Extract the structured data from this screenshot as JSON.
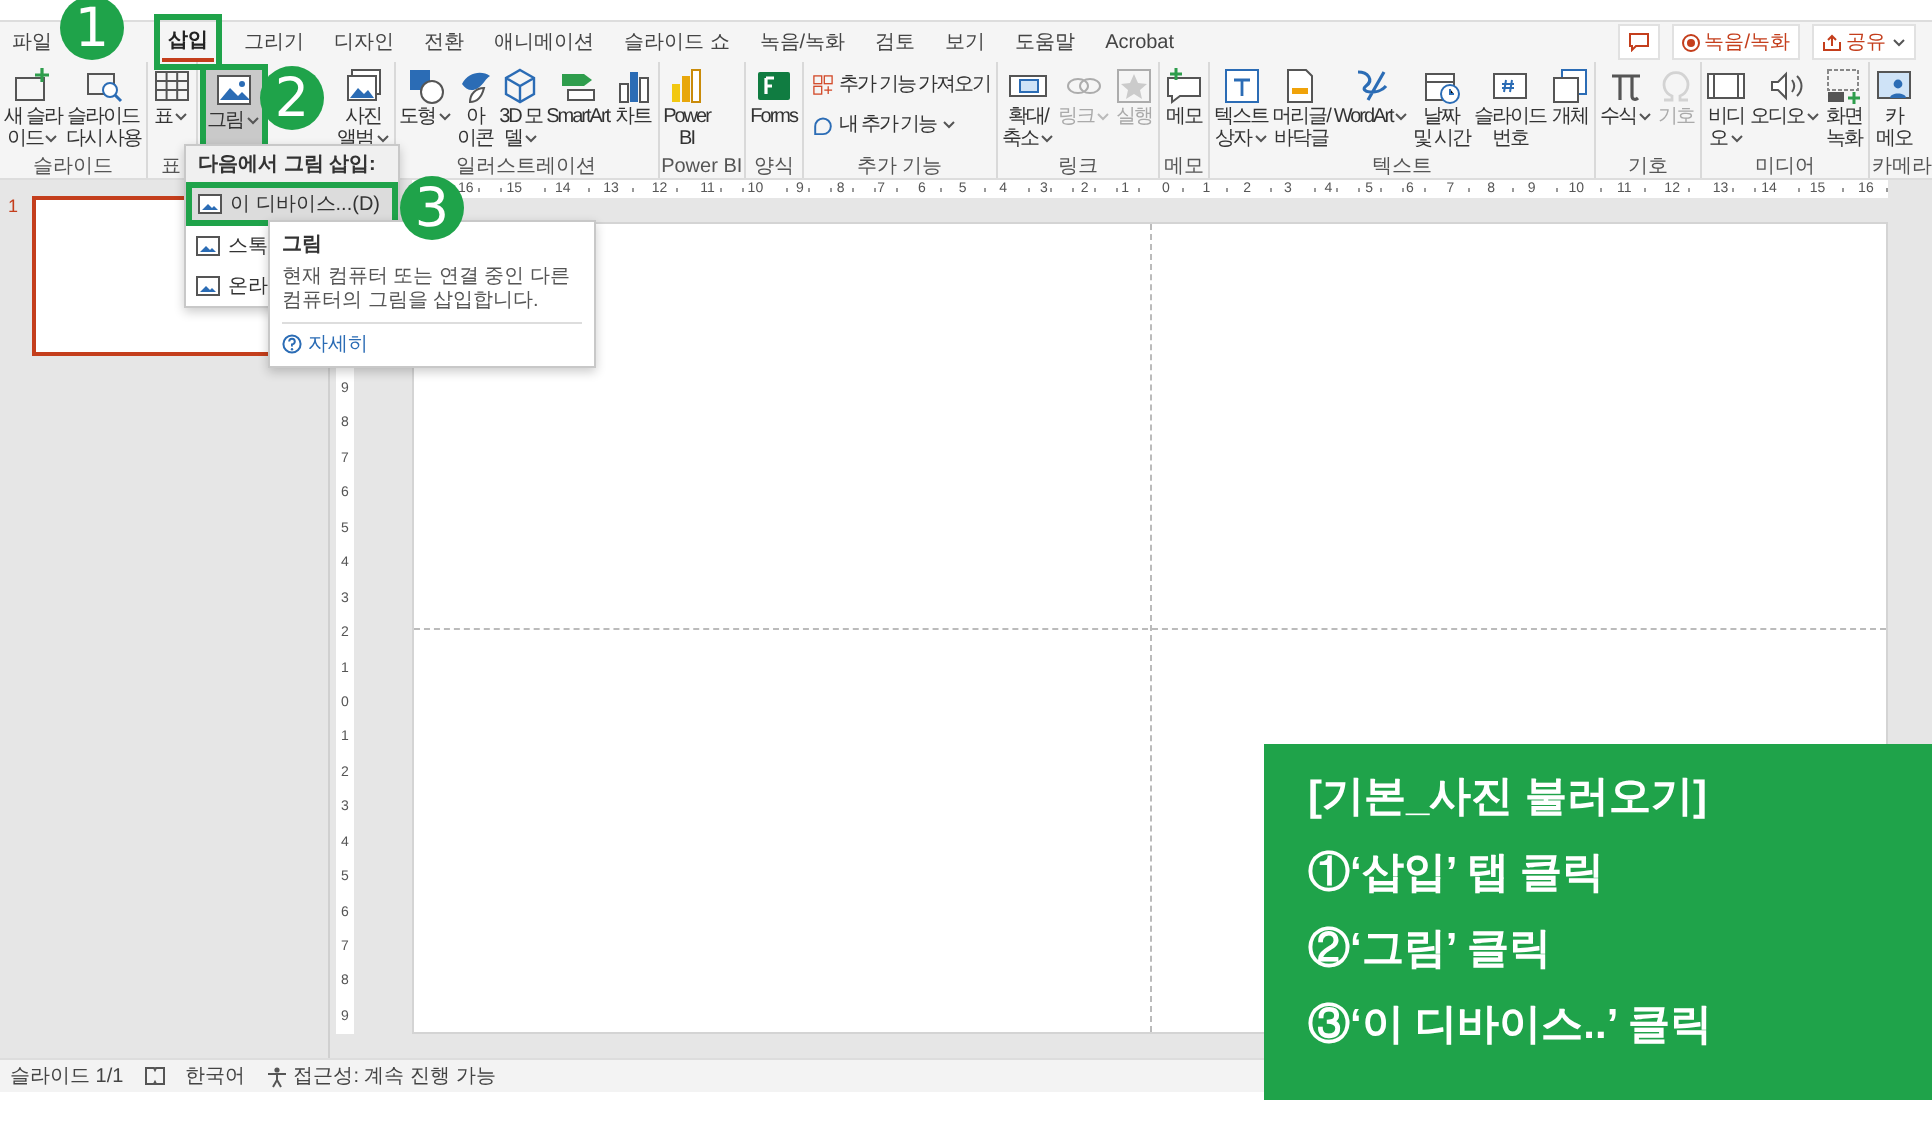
{
  "tabs": [
    {
      "label": "파일",
      "selected": false
    },
    {
      "label": "삽입",
      "selected": true
    },
    {
      "label": "그리기",
      "selected": false
    },
    {
      "label": "디자인",
      "selected": false
    },
    {
      "label": "전환",
      "selected": false
    },
    {
      "label": "애니메이션",
      "selected": false
    },
    {
      "label": "슬라이드 쇼",
      "selected": false
    },
    {
      "label": "녹음/녹화",
      "selected": false
    },
    {
      "label": "검토",
      "selected": false
    },
    {
      "label": "보기",
      "selected": false
    },
    {
      "label": "도움말",
      "selected": false
    },
    {
      "label": "Acrobat",
      "selected": false
    }
  ],
  "header_buttons": [
    {
      "kind": "comment"
    },
    {
      "kind": "record",
      "label": "녹음/녹화"
    },
    {
      "kind": "share",
      "label": "공유"
    }
  ],
  "ribbon_groups": [
    {
      "label": "슬라이드",
      "kind": "large",
      "buttons": [
        {
          "lines": [
            "새 슬라",
            "이드"
          ],
          "dropdown": true,
          "pressed": false,
          "disabled": false
        },
        {
          "lines": [
            "슬라이드",
            "다시 사용"
          ],
          "dropdown": false,
          "pressed": false,
          "disabled": false
        }
      ]
    },
    {
      "label": "표",
      "kind": "large",
      "buttons": [
        {
          "lines": [
            "표"
          ],
          "dropdown": true,
          "pressed": false,
          "disabled": false
        }
      ]
    },
    {
      "kind": "large",
      "buttons": [
        {
          "lines": [
            "그림"
          ],
          "dropdown": true,
          "pressed": true,
          "disabled": false
        },
        {
          "lines": [
            "사진",
            "앨범"
          ],
          "dropdown": true,
          "pressed": false,
          "disabled": false
        }
      ]
    },
    {
      "label": "일러스트레이션",
      "kind": "large",
      "buttons": [
        {
          "lines": [
            "도형"
          ],
          "dropdown": true,
          "pressed": false,
          "disabled": false
        },
        {
          "lines": [
            "아",
            "이콘"
          ],
          "dropdown": false,
          "pressed": false,
          "disabled": false
        },
        {
          "lines": [
            "3D 모",
            "델"
          ],
          "dropdown": true,
          "pressed": false,
          "disabled": false
        },
        {
          "lines": [
            "SmartArt"
          ],
          "dropdown": false,
          "pressed": false,
          "disabled": false
        },
        {
          "lines": [
            "차트"
          ],
          "dropdown": false,
          "pressed": false,
          "disabled": false
        }
      ]
    },
    {
      "label": "Power BI",
      "kind": "large",
      "buttons": [
        {
          "lines": [
            "Power",
            "BI"
          ],
          "dropdown": false,
          "pressed": false,
          "disabled": false
        }
      ]
    },
    {
      "label": "양식",
      "kind": "large",
      "buttons": [
        {
          "lines": [
            "Forms"
          ],
          "dropdown": false,
          "pressed": false,
          "disabled": false
        }
      ]
    },
    {
      "label": "추가 기능",
      "kind": "small",
      "buttons": [
        {
          "lines": [
            "추가 기능 가져오기"
          ],
          "dropdown": false,
          "pressed": false,
          "disabled": false
        },
        {
          "lines": [
            "내 추가 기능"
          ],
          "dropdown": true,
          "pressed": false,
          "disabled": false
        }
      ]
    },
    {
      "label": "링크",
      "kind": "large",
      "buttons": [
        {
          "lines": [
            "확대/",
            "축소"
          ],
          "dropdown": true,
          "pressed": false,
          "disabled": false
        },
        {
          "lines": [
            "링크"
          ],
          "dropdown": true,
          "pressed": false,
          "disabled": true
        },
        {
          "lines": [
            "실행"
          ],
          "dropdown": false,
          "pressed": false,
          "disabled": true
        }
      ]
    },
    {
      "label": "메모",
      "kind": "large",
      "buttons": [
        {
          "lines": [
            "메모"
          ],
          "dropdown": false,
          "pressed": false,
          "disabled": false
        }
      ]
    },
    {
      "label": "텍스트",
      "kind": "large",
      "buttons": [
        {
          "lines": [
            "텍스트",
            "상자"
          ],
          "dropdown": true,
          "pressed": false,
          "disabled": false
        },
        {
          "lines": [
            "머리글/",
            "바닥글"
          ],
          "dropdown": false,
          "pressed": false,
          "disabled": false
        },
        {
          "lines": [
            "WordArt"
          ],
          "dropdown": true,
          "pressed": false,
          "disabled": false
        },
        {
          "lines": [
            "날짜",
            "및 시간"
          ],
          "dropdown": false,
          "pressed": false,
          "disabled": false
        },
        {
          "lines": [
            "슬라이드",
            "번호"
          ],
          "dropdown": false,
          "pressed": false,
          "disabled": false
        },
        {
          "lines": [
            "개체"
          ],
          "dropdown": false,
          "pressed": false,
          "disabled": false
        }
      ]
    },
    {
      "label": "기호",
      "kind": "large",
      "buttons": [
        {
          "lines": [
            "수식"
          ],
          "dropdown": true,
          "pressed": false,
          "disabled": false
        },
        {
          "lines": [
            "기호"
          ],
          "dropdown": false,
          "pressed": false,
          "disabled": true
        }
      ]
    },
    {
      "label": "미디어",
      "kind": "large",
      "buttons": [
        {
          "lines": [
            "비디",
            "오"
          ],
          "dropdown": true,
          "pressed": false,
          "disabled": false
        },
        {
          "lines": [
            "오디오"
          ],
          "dropdown": true,
          "pressed": false,
          "disabled": false
        },
        {
          "lines": [
            "화면",
            "녹화"
          ],
          "dropdown": false,
          "pressed": false,
          "disabled": false
        }
      ]
    },
    {
      "label": "카메라",
      "kind": "large",
      "buttons": [
        {
          "lines": [
            "카",
            "메오"
          ],
          "dropdown": false,
          "pressed": false,
          "disabled": false
        }
      ]
    }
  ],
  "picture_menu": {
    "header": "다음에서 그림 삽입:",
    "items": [
      {
        "label": "이 디바이스...(D)",
        "selected": true
      },
      {
        "label": "스톡",
        "selected": false
      },
      {
        "label": "온라",
        "selected": false
      }
    ]
  },
  "tooltip": {
    "title": "그림",
    "body": "현재 컴퓨터 또는 연결 중인 다른 컴퓨터의 그림을 삽입합니다.",
    "link": "자세히"
  },
  "ruler": {
    "horizontal": [
      "16",
      "15",
      "14",
      "13",
      "12",
      "11",
      "10",
      "9",
      "8",
      "7",
      "6",
      "5",
      "4",
      "3",
      "2",
      "1",
      "0",
      "1",
      "2",
      "3",
      "4",
      "5",
      "6",
      "7",
      "8",
      "9",
      "10",
      "11",
      "12",
      "13",
      "14",
      "15",
      "16"
    ],
    "vertical": [
      "9",
      "8",
      "7",
      "6",
      "5",
      "4",
      "3",
      "2",
      "1",
      "0",
      "1",
      "2",
      "3",
      "4",
      "5",
      "6",
      "7",
      "8",
      "9"
    ]
  },
  "slides": [
    {
      "number": "1",
      "selected": true
    }
  ],
  "status_bar": {
    "slide": "슬라이드 1/1",
    "language": "한국어",
    "accessibility": "접근성: 계속 진행 가능"
  },
  "steps": [
    "1",
    "2",
    "3"
  ],
  "instructions": {
    "title": "[기본_사진 불러오기]",
    "lines": [
      "①‘삽입’ 탭 클릭",
      "②‘그림’ 클릭",
      "③‘이 디바이스..’ 클릭"
    ]
  }
}
